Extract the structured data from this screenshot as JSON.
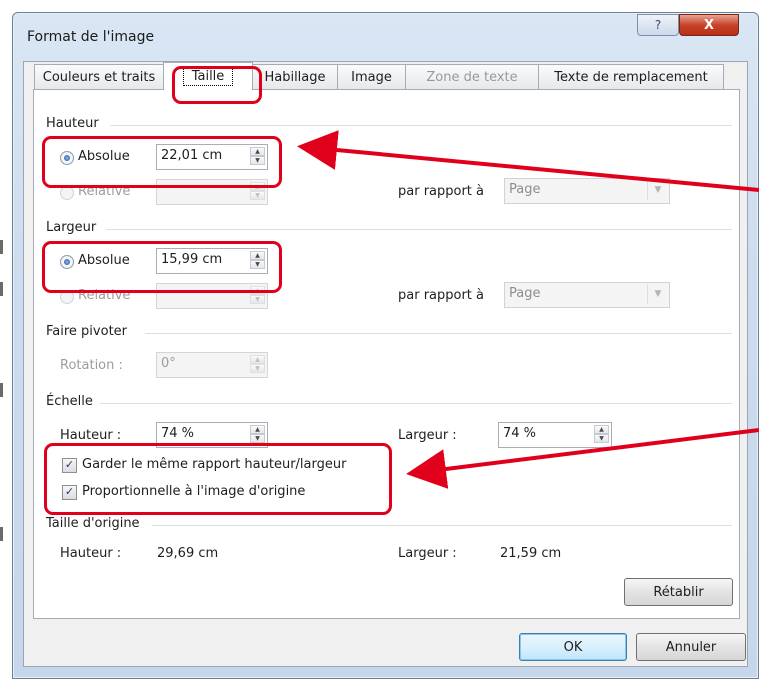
{
  "window": {
    "title": "Format de l'image",
    "help_glyph": "?",
    "close_glyph": "X"
  },
  "tabs": [
    {
      "label": "Couleurs et traits"
    },
    {
      "label": "Taille"
    },
    {
      "label": "Habillage"
    },
    {
      "label": "Image"
    },
    {
      "label": "Zone de texte"
    },
    {
      "label": "Texte de remplacement"
    }
  ],
  "hauteur": {
    "section": "Hauteur",
    "absolue_label": "Absolue",
    "absolue_value": "22,01 cm",
    "relative_label": "Relative",
    "par_rapport_label": "par rapport à",
    "par_rapport_value": "Page"
  },
  "largeur": {
    "section": "Largeur",
    "absolue_label": "Absolue",
    "absolue_value": "15,99 cm",
    "relative_label": "Relative",
    "par_rapport_label": "par rapport à",
    "par_rapport_value": "Page"
  },
  "pivoter": {
    "section": "Faire pivoter",
    "rotation_label": "Rotation :",
    "rotation_value": "0°"
  },
  "echelle": {
    "section": "Échelle",
    "hauteur_label": "Hauteur :",
    "hauteur_value": "74 %",
    "largeur_label": "Largeur :",
    "largeur_value": "74 %",
    "garder_label": "Garder le même rapport hauteur/largeur",
    "proportionnelle_label": "Proportionnelle à l'image d'origine"
  },
  "origine": {
    "section": "Taille d'origine",
    "hauteur_label": "Hauteur :",
    "hauteur_value": "29,69 cm",
    "largeur_label": "Largeur :",
    "largeur_value": "21,59 cm"
  },
  "buttons": {
    "retablir": "Rétablir",
    "ok": "OK",
    "annuler": "Annuler"
  },
  "colors": {
    "highlight": "#e0001b",
    "close_button": "#c7442a"
  }
}
